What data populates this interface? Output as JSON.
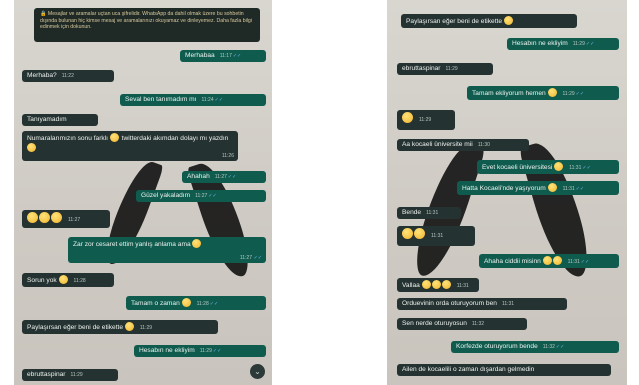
{
  "left": {
    "banner": "🔒 Mesajlar ve aramalar uçtan uca şifrelidir. WhatsApp da dahil olmak üzere bu sohbetin dışında bulunan hiç kimse mesaj ve aramalarınızı okuyamaz ve dinleyemez. Daha fazla bilgi edinmek için dokunun.",
    "messages": [
      {
        "text": "Merhabaa",
        "time": "11:17",
        "dir": "out"
      },
      {
        "text": "Merhaba?",
        "time": "11:22",
        "dir": "in"
      },
      {
        "text": "Seval ben tanımadım mı",
        "time": "11:24",
        "dir": "out"
      },
      {
        "text": "Tanıyamadım",
        "time": "11:26",
        "dir": "in"
      },
      {
        "text_a": "Numaralarımızın sonu farklı",
        "text_b": "twitterdaki akımdan dolayı mı yazdın",
        "time": "11:26",
        "dir": "in"
      },
      {
        "text": "Ahahah",
        "time": "11:27",
        "dir": "out"
      },
      {
        "text": "Güzel yakaladım",
        "time": "11:27",
        "dir": "out"
      },
      {
        "text": "",
        "time": "11:27",
        "dir": "in",
        "emoji_count": 3
      },
      {
        "text": "Zar zor cesaret ettim yanlış anlama ama",
        "time": "11:27",
        "dir": "out"
      },
      {
        "text": "Sorun yok",
        "time": "11:28",
        "dir": "in"
      },
      {
        "text": "Tamam o zaman",
        "time": "11:28",
        "dir": "out"
      },
      {
        "text": "Paylaşırsan eğer beni de etikette",
        "time": "11:29",
        "dir": "in"
      },
      {
        "text": "Hesabın ne ekliyim",
        "time": "11:29",
        "dir": "out"
      },
      {
        "text": "ebruttaspinar",
        "time": "11:29",
        "dir": "in"
      }
    ]
  },
  "right": {
    "messages": [
      {
        "text": "Paylaşırsan eğer beni de etikette",
        "time": "11:29",
        "dir": "in"
      },
      {
        "text": "Hesabın ne ekliyim",
        "time": "11:29",
        "dir": "out"
      },
      {
        "text": "ebruttaspinar",
        "time": "11:29",
        "dir": "in"
      },
      {
        "text": "Tamam ekliyorum hemen",
        "time": "11:29",
        "dir": "out"
      },
      {
        "text": "",
        "time": "11:29",
        "dir": "in"
      },
      {
        "text": "Aa kocaeli üniversite mii",
        "time": "11:30",
        "dir": "in"
      },
      {
        "text": "Evet kocaeli üniversitesi",
        "time": "11:31",
        "dir": "out"
      },
      {
        "text": "Hatta Kocaeli'nde yaşıyorum",
        "time": "11:31",
        "dir": "out"
      },
      {
        "text": "Bende",
        "time": "11:31",
        "dir": "in"
      },
      {
        "text": "",
        "time": "11:31",
        "dir": "in"
      },
      {
        "text": "Ahaha ciddii misinn",
        "time": "11:31",
        "dir": "out"
      },
      {
        "text": "Vallaa",
        "time": "11:31",
        "dir": "in"
      },
      {
        "text": "Orduevinin orda oturuyorum ben",
        "time": "11:31",
        "dir": "in"
      },
      {
        "text": "Sen nerde oturuyosun",
        "time": "11:32",
        "dir": "in"
      },
      {
        "text": "Korfezde oturuyorum bende",
        "time": "11:32",
        "dir": "out"
      },
      {
        "text": "Ailen de kocaelili o zaman dışardan gelmedin",
        "time": "",
        "dir": "in"
      }
    ]
  },
  "icons": {
    "scroll_down": "chevron-down-icon",
    "read_receipt": "double-check-icon"
  },
  "colors": {
    "incoming": "#243231",
    "outgoing": "#0f5c4f",
    "read_check": "#6bb2e8"
  }
}
